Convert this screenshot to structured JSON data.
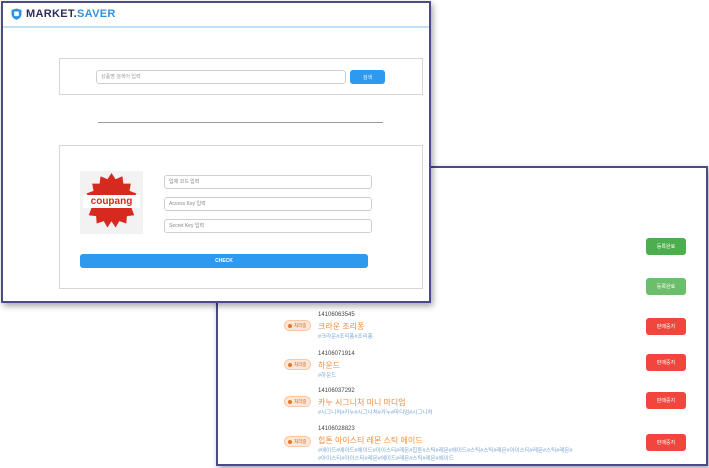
{
  "app": {
    "logo_main": "MARKET.",
    "logo_accent": "SAVER"
  },
  "search": {
    "placeholder": "상품명 검색어 입력",
    "button_label": "검색"
  },
  "credentials": {
    "brand": "coupang",
    "vendor_code_placeholder": "업체 코드 입력",
    "access_key_placeholder": "Access Key 입력",
    "secret_key_placeholder": "Secret Key 입력",
    "check_label": "CHECK"
  },
  "status_buttons": {
    "top": [
      "등록완료",
      "등록완료"
    ]
  },
  "products": [
    {
      "badge": "처리중",
      "id": "14106063545",
      "name": "크라운 조리퐁",
      "tags": "#크라운#조리퐁#조리퐁",
      "action": "판매중지"
    },
    {
      "badge": "처리중",
      "id": "14106071914",
      "name": "하운드",
      "tags": "#하운드",
      "action": "판매중지"
    },
    {
      "badge": "처리중",
      "id": "14106037292",
      "name": "카누 시그니처 미니 마디엄",
      "tags": "#시그니처#카누#시그니처#카누#마디엄#시그니처",
      "action": "판매중지"
    },
    {
      "badge": "처리중",
      "id": "14106028823",
      "name": "힙톤 아이스티 레몬 스틱 에이드",
      "tags": "#에이드#에이드#에이드#아이스티#레몬#힙톤#스틱#레몬#에이드#스틱#스틱#레몬#아이스티#레몬#스틱#레몬#",
      "tags2": "#아이스티#아이스티#레몬#에이드#레몬#스틱#레몬#에이드",
      "action": "판매중지"
    }
  ],
  "colors": {
    "accent": "#2d99ef",
    "brand_dark": "#2d2f5a",
    "status_green": "#4cae4c",
    "status_red": "#f1453d",
    "product_name": "#f08a3c",
    "tags": "#7aa7d6",
    "coupang_red": "#d72a1f"
  },
  "icons": {
    "logo": "shield-icon",
    "badge": "dot-icon",
    "coupang": "seal-icon"
  }
}
